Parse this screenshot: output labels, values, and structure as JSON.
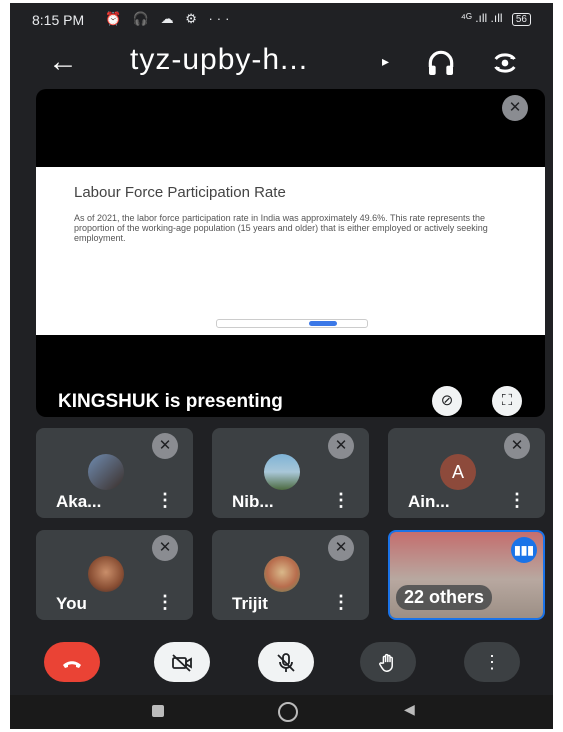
{
  "status_bar": {
    "time": "8:15 PM",
    "icons_left": "⏰ 🎧 ☁ ⚙ ···",
    "signal": "⁴ᴳ .ıll .ıll",
    "battery": "56"
  },
  "header": {
    "back_icon": "←",
    "meeting_code": "tyz-upby-h...",
    "caret": "▸",
    "audio_icon": "headphones-icon",
    "switch_icon": "switch-camera-icon"
  },
  "presentation": {
    "slide_title": "Labour Force Participation Rate",
    "slide_body": "As of 2021, the labor force participation rate in India was approximately 49.6%. This rate represents the proportion of the working-age population (15 years and older) that is either employed or actively seeking employment.",
    "presenter_text": "KINGSHUK is presenting"
  },
  "participants": [
    {
      "name": "Aka...",
      "more": "⋮"
    },
    {
      "name": "Nib...",
      "more": "⋮"
    },
    {
      "name": "Ain...",
      "more": "⋮",
      "avatar_letter": "A"
    },
    {
      "name": "You",
      "more": "⋮"
    },
    {
      "name": "Trijit",
      "more": "⋮"
    },
    {
      "name": "22 others"
    }
  ],
  "controls": {
    "end_call": "end-call-icon",
    "camera": "camera-off-icon",
    "mic": "mic-off-icon",
    "raise_hand": "raise-hand-icon",
    "more": "⋮"
  },
  "colors": {
    "background": "#202124",
    "tile": "#3c4043",
    "end_call": "#ea4335",
    "accent": "#1a73e8"
  }
}
